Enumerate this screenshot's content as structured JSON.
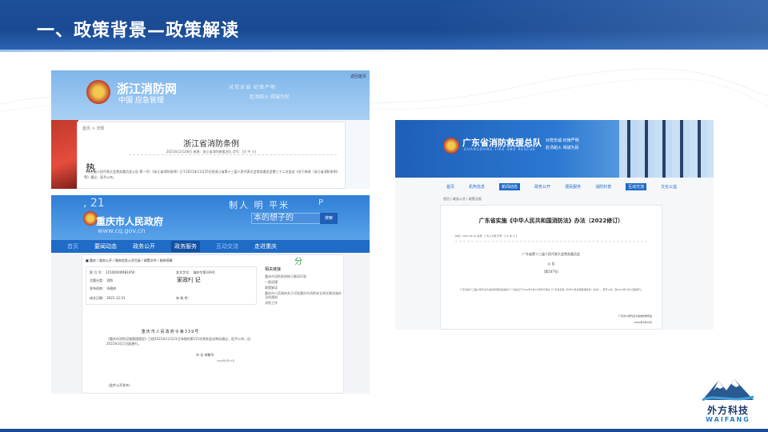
{
  "header": {
    "title": "一、政策背景—政策解读"
  },
  "zhejiang": {
    "site_name": "浙江消防网",
    "sub_text": "中国 应急管理",
    "slogan": "对党忠诚 纪律严明",
    "slogan2": "赴汤蹈火 竭诚为民",
    "top_link": "返回首页",
    "breadcrumb": "首页 > 法规",
    "doc_title": "浙江省消防条例",
    "meta": "2021年12月28日 来源：浙江省消防救援总队 字号：[大 中 小]",
    "hot_label": "热",
    "body": "（浙江省人民代表大会常务委员会公告 第一号）《浙江省消防条例》已于2021年11月25日经浙江省第十三届人民代表大会常务委员会第三十二次会议《关于修改〈浙江省消防条例〉等》通过，现予公布。"
  },
  "chongqing": {
    "banner_number": ", 21",
    "site_name": "重庆市人民政府",
    "domain": "www.cq.gov.cn",
    "slogan": "制人 明 平米",
    "slogan_p": "P",
    "search_placeholder": "本的想子的",
    "search_button": "搜索",
    "nav": [
      "首页",
      "要闻动态",
      "政务公开",
      "政务服务",
      "互动交流",
      "走进重庆"
    ],
    "green_char": "分",
    "breadcrumb": "■ 重庆 / 政务公开 / 政府信息公开目录 / 政策文件 / 政府规章",
    "card_rows": [
      "索 引 号：  11500000MB1950  ",
      "主题分类：  消防",
      "发布机构：  市政府",
      "成文日期：  2021-12-31"
    ],
    "card_home": "家政F| 记",
    "card_doc_no": "发文字号：  渝府令第339号",
    "card_valid": "有 效 性：",
    "side_title": "相关链接",
    "side_items": [
      "重庆市消防条例修订解读问答",
      "一图读懂",
      "政策解读",
      "重庆市人民政府关于印发重庆市消防安全责任制实施办法的通知",
      "消防工作"
    ],
    "order_title": "重庆市人民政府令第339号",
    "body": "《重庆市消防设施管理规定》已经2021年12月31日市政府第155次常务会议审议通过，现予公布，自2022年3月1日起施行。",
    "mayor": "市 长   胡衡华",
    "mayor_date": "2022年1月17日",
    "source": "（此件公开发布）"
  },
  "guangdong": {
    "site_name": "广东省消防救援总队",
    "en_name": "GUANGDONG FIRE AND RESCUE",
    "slogan_line1": "对党忠诚 纪律严明",
    "slogan_line2": "赴汤蹈火 竭诚为民",
    "nav": [
      "首页",
      "机构信息",
      "新闻动态",
      "政务公开",
      "便民服务",
      "消防科普",
      "互动交流",
      "文化公益"
    ],
    "breadcrumb": "首页 | 政务公开 | 政策法规",
    "doc_title": "广东省实施《中华人民共和国消防法》办法（2022修订）",
    "meta": "时间：2022-04-01  来源：广东人大网  字号：【 大 中 小 】",
    "issuer": "广东省第十三届人民代表大会常务委员会",
    "notice": "公  告",
    "notice_no": "（第107号）",
    "para": "广东省第十三届人民代表大会常务委员会第四十一次会议于2022年3月29日修订通过《广东省实施〈中华人民共和国消防法〉办法》，现予公布，自2022年7月1日起施行。",
    "sign_org": "广东省人民代表大会常务委员会",
    "sign_date": "2022年3月29日"
  },
  "logo": {
    "name_cn": "外方科技",
    "name_en": "WAIFANG"
  },
  "colors": {
    "header": "#1a4a93",
    "accent": "#2b78d2",
    "logo_text": "#1b3a6b"
  }
}
